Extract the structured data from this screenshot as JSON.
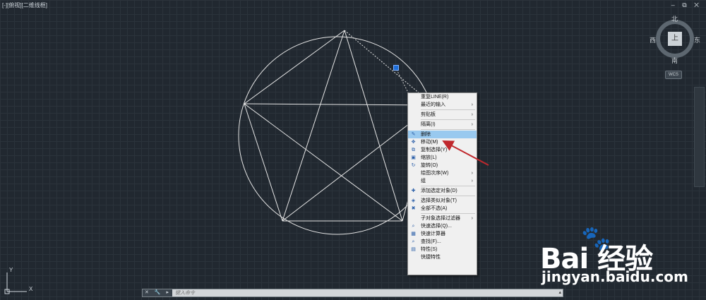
{
  "viewport": {
    "label": "[-][俯视][二维线框]",
    "window_controls": "– ⧉ ✕"
  },
  "viewcube": {
    "north": "北",
    "south": "南",
    "west": "西",
    "east": "东",
    "face": "上",
    "wcs": "WCS"
  },
  "context_menu": {
    "items": [
      {
        "label": "重复LINE(R)",
        "submenu": false,
        "icon": ""
      },
      {
        "label": "最近的输入",
        "submenu": true,
        "icon": ""
      },
      {
        "label": "剪贴板",
        "submenu": true,
        "icon": ""
      },
      {
        "label": "隔离(I)",
        "submenu": true,
        "icon": ""
      },
      {
        "label": "删除",
        "submenu": false,
        "icon": "eraser-icon",
        "highlighted": true
      },
      {
        "label": "移动(M)",
        "submenu": false,
        "icon": "move-icon"
      },
      {
        "label": "复制选择(Y)",
        "submenu": false,
        "icon": "copy-icon"
      },
      {
        "label": "缩放(L)",
        "submenu": false,
        "icon": "scale-icon"
      },
      {
        "label": "旋转(O)",
        "submenu": false,
        "icon": "rotate-icon"
      },
      {
        "label": "绘图次序(W)",
        "submenu": true,
        "icon": ""
      },
      {
        "label": "组",
        "submenu": true,
        "icon": ""
      },
      {
        "label": "添加选定对象(D)",
        "submenu": false,
        "icon": "add-selected-icon"
      },
      {
        "label": "选择类似对象(T)",
        "submenu": false,
        "icon": "select-similar-icon"
      },
      {
        "label": "全部不选(A)",
        "submenu": false,
        "icon": "deselect-all-icon"
      },
      {
        "label": "子对象选择过滤器",
        "submenu": true,
        "icon": ""
      },
      {
        "label": "快速选择(Q)...",
        "submenu": false,
        "icon": "quick-select-icon"
      },
      {
        "label": "快速计算器",
        "submenu": false,
        "icon": "calculator-icon"
      },
      {
        "label": "查找(F)...",
        "submenu": false,
        "icon": "find-icon"
      },
      {
        "label": "特性(S)",
        "submenu": false,
        "icon": "properties-icon"
      },
      {
        "label": "快捷特性",
        "submenu": false,
        "icon": ""
      }
    ]
  },
  "ucs": {
    "x": "X",
    "y": "Y"
  },
  "command_line": {
    "buttons": "✕ 🔧 ▸",
    "placeholder": "键入命令",
    "scroll": "▴"
  },
  "watermark": {
    "paw": "🐾",
    "brand": "Bai  经验",
    "url": "jingyan.baidu.com"
  },
  "colors": {
    "background": "#212830",
    "drawing_lines": "#e6e6e6",
    "menu_highlight": "#99c9ef",
    "annotation_arrow": "#c0282d",
    "grip": "#1e6fd9"
  }
}
